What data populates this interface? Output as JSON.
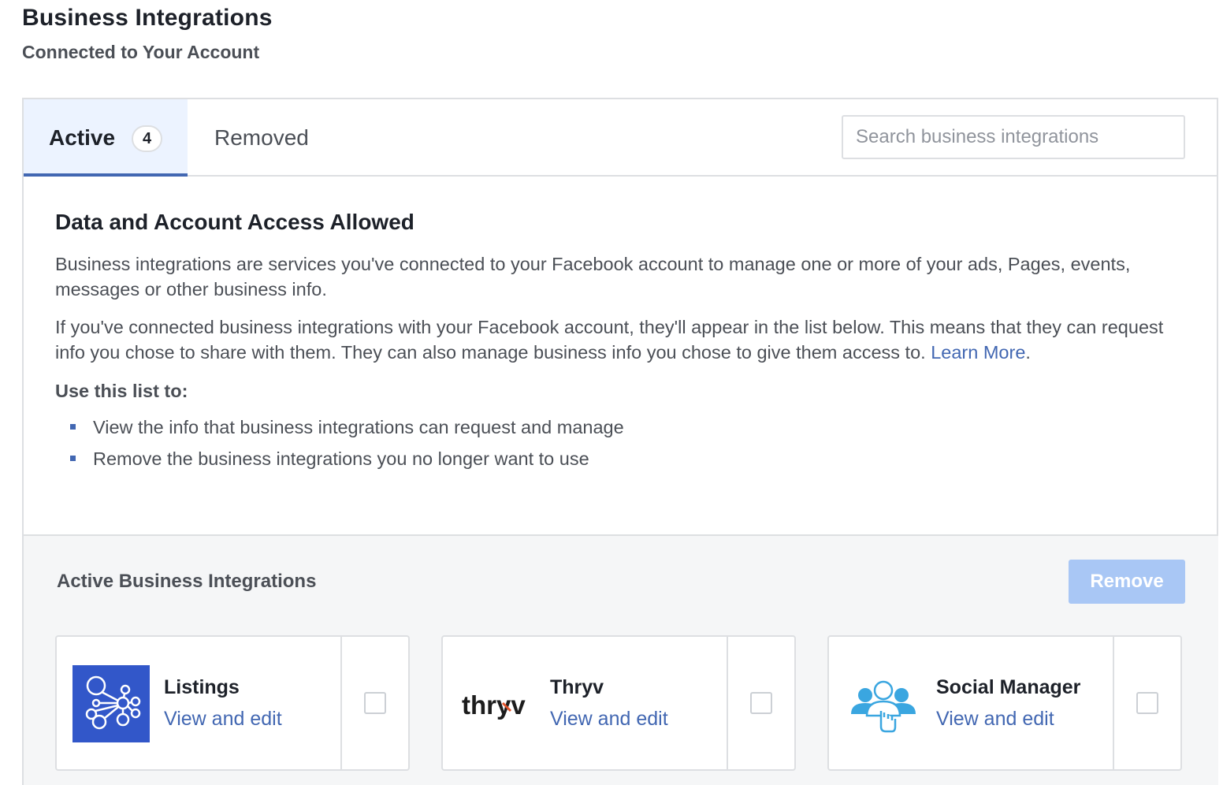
{
  "header": {
    "title": "Business Integrations",
    "subtitle": "Connected to Your Account"
  },
  "tabs": {
    "active_label": "Active",
    "active_count": "4",
    "removed_label": "Removed"
  },
  "search": {
    "placeholder": "Search business integrations",
    "value": ""
  },
  "info": {
    "title": "Data and Account Access Allowed",
    "paragraph1": "Business integrations are services you've connected to your Facebook account to manage one or more of your ads, Pages, events, messages or other business info.",
    "paragraph2": "If you've connected business integrations with your Facebook account, they'll appear in the list below. This means that they can request info you chose to share with them. They can also manage business info you chose to give them access to.",
    "learn_more": "Learn More",
    "period": ".",
    "use_title": "Use this list to:",
    "use_items": [
      "View the info that business integrations can request and manage",
      "Remove the business integrations you no longer want to use"
    ]
  },
  "integrations": {
    "title": "Active Business Integrations",
    "remove_label": "Remove",
    "items": [
      {
        "name": "Listings",
        "link": "View and edit",
        "logo_text": "",
        "logo_icon": "listings-network-icon",
        "logo_color": "#3257c9",
        "checked": false
      },
      {
        "name": "Thryv",
        "link": "View and edit",
        "logo_text": "thryv",
        "logo_icon": "thryv-logo",
        "logo_color": "#1d1d1d",
        "checked": false
      },
      {
        "name": "Social Manager",
        "link": "View and edit",
        "logo_text": "",
        "logo_icon": "social-manager-people-icon",
        "logo_color": "#3aa6e0",
        "checked": false
      }
    ]
  },
  "colors": {
    "accent": "#4267b2",
    "tab_active_bg": "#ecf3ff",
    "remove_disabled": "#a9c7f5",
    "border": "#dddfe2"
  }
}
